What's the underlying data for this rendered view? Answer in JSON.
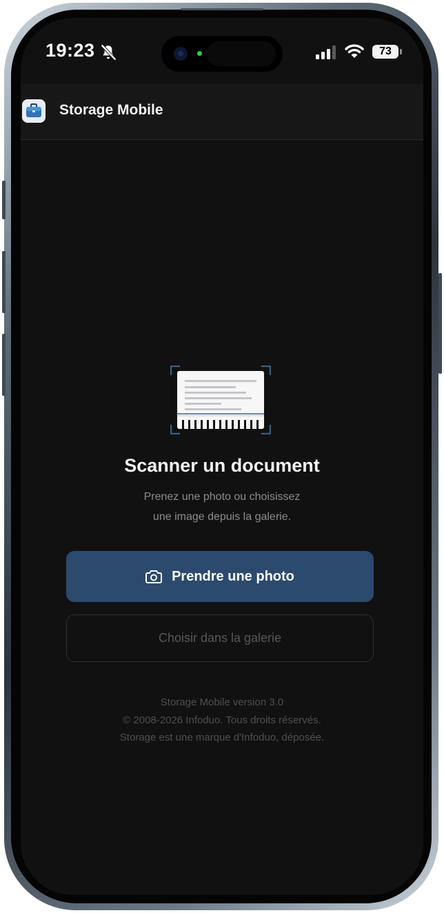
{
  "status_bar": {
    "time": "19:23",
    "battery": "73"
  },
  "header": {
    "app_title": "Storage Mobile",
    "app_icon": "briefcase-icon"
  },
  "main": {
    "illustration_icon": "document-scan-icon",
    "headline": "Scanner un document",
    "subtext_line1": "Prenez une photo ou choisissez",
    "subtext_line2": "une image depuis la galerie."
  },
  "actions": {
    "take_photo_label": "Prendre une photo",
    "take_photo_icon": "camera-icon",
    "gallery_label": "Choisir dans la galerie"
  },
  "footer": {
    "line1": "Storage Mobile version 3.0",
    "line2": "© 2008-2026 Infoduo. Tous droits réservés.",
    "line3": "Storage est une marque d'Infoduo, déposée."
  },
  "colors": {
    "background": "#111111",
    "header": "#171717",
    "primary_button": "#2b4a6e",
    "accent_bracket": "#3c5c82"
  }
}
